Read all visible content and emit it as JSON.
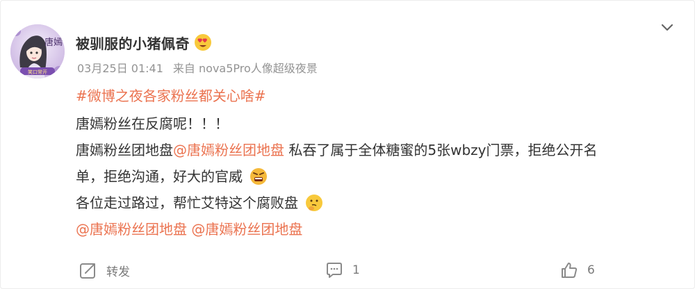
{
  "post": {
    "username": "被驯服的小猪佩奇",
    "username_emoji": "heart-eyes-emoji",
    "avatar": {
      "text": "唐嫣",
      "caption": "笑口常开"
    },
    "meta": {
      "time": "03月25日 01:41",
      "source": "来自 nova5Pro人像超级夜景"
    },
    "hashtag": "#微博之夜各家粉丝都关心啥#",
    "line1": "唐嫣粉丝在反腐呢！！！",
    "line2_prefix": "唐嫣粉丝团地盘",
    "line2_mention": "@唐嫣粉丝团地盘",
    "line2_suffix": " 私吞了属于全体糖蜜的5张wbzy门票，拒绝公开名",
    "line3": "单，拒绝沟通，好大的官威",
    "line3_emoji": "angry-emoji",
    "line4": "各位走过路过，帮忙艾特这个腐败盘",
    "line4_emoji": "thinking-emoji",
    "mentions": [
      "@唐嫣粉丝团地盘",
      "@唐嫣粉丝团地盘"
    ]
  },
  "footer": {
    "repost_label": "转发",
    "comment_count": "1",
    "like_count": "6"
  },
  "colors": {
    "link": "#eb7350",
    "text": "#333333",
    "meta": "#939393",
    "icon": "#7a7a7a"
  }
}
